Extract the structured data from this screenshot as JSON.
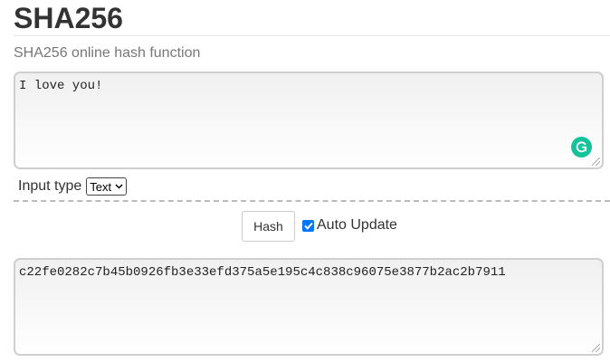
{
  "header": {
    "title": "SHA256",
    "subtitle": "SHA256 online hash function"
  },
  "input": {
    "value": "I love you!"
  },
  "input_type": {
    "label": "Input type",
    "selected": "Text"
  },
  "controls": {
    "hash_label": "Hash",
    "auto_update_label": "Auto Update",
    "auto_update_checked": true
  },
  "output": {
    "value": "c22fe0282c7b45b0926fb3e33efd375a5e195c4c838c96075e3877b2ac2b7911"
  },
  "icons": {
    "grammarly": "grammarly-icon",
    "checkmark": "checkmark-icon",
    "dropdown": "chevron-down-icon"
  },
  "colors": {
    "grammarly": "#15c39a",
    "checkbox": "#0075ff",
    "title": "#333333",
    "subtitle": "#777777"
  }
}
